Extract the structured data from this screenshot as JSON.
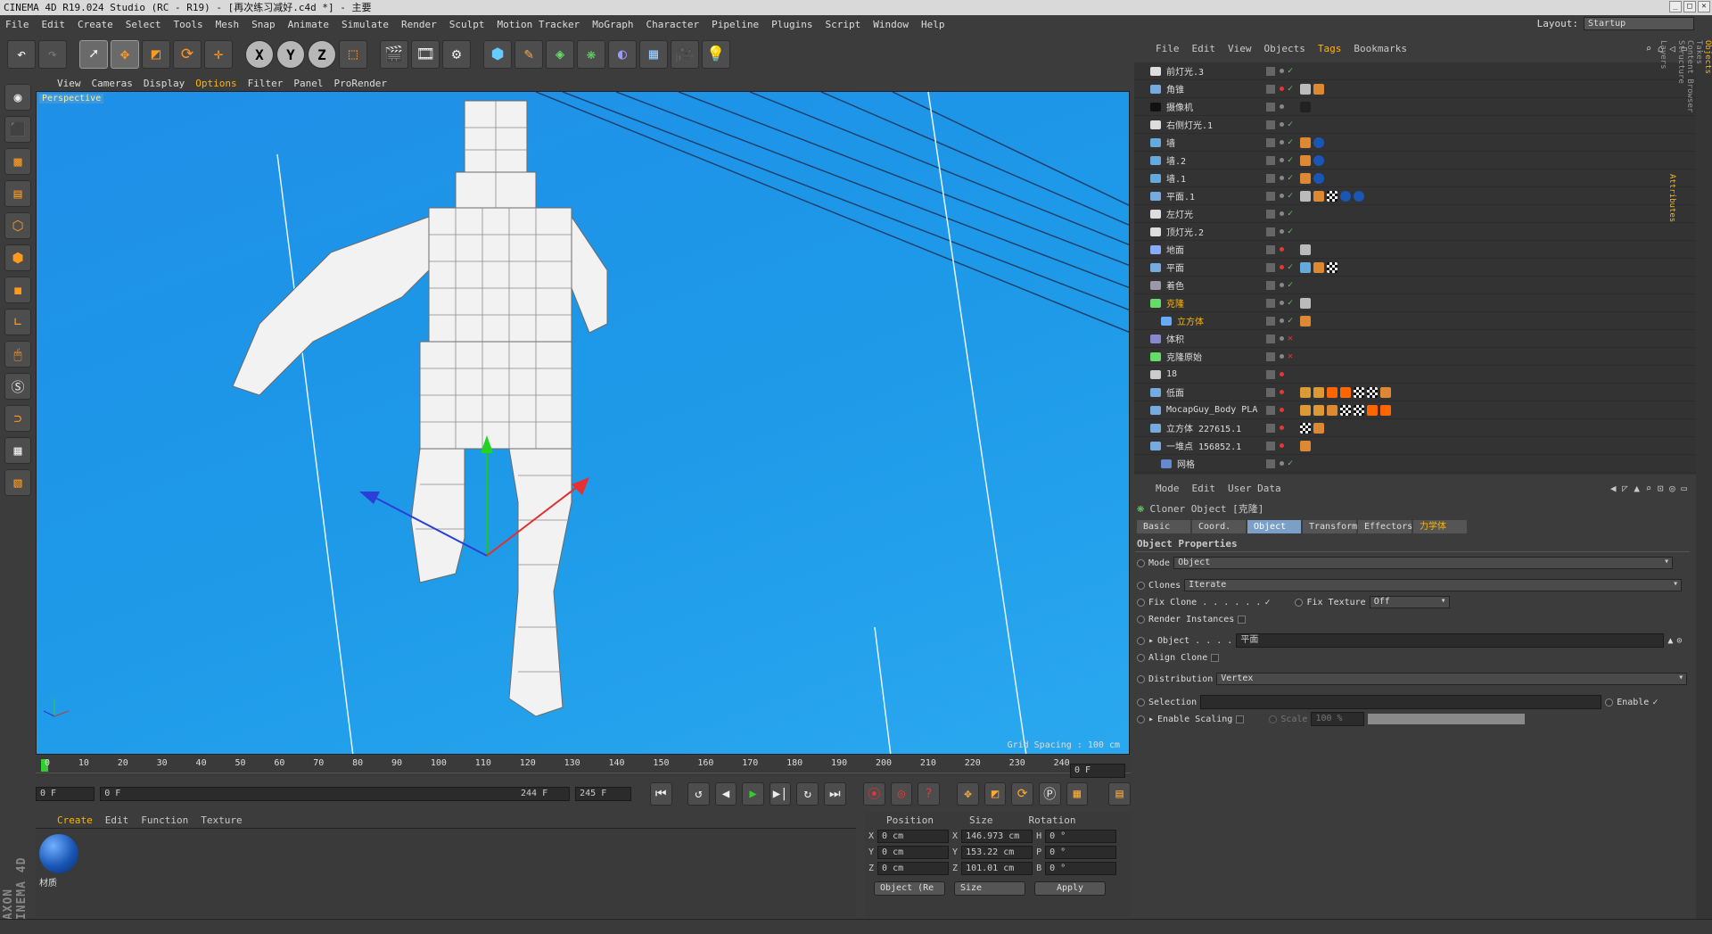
{
  "window": {
    "title": "CINEMA 4D R19.024 Studio (RC - R19) - [再次练习减好.c4d *] - 主要",
    "min": "_",
    "max": "□",
    "close": "✕"
  },
  "menubar": {
    "items": [
      "File",
      "Edit",
      "Create",
      "Select",
      "Tools",
      "Mesh",
      "Snap",
      "Animate",
      "Simulate",
      "Render",
      "Sculpt",
      "Motion Tracker",
      "MoGraph",
      "Character",
      "Pipeline",
      "Plugins",
      "Script",
      "Window",
      "Help"
    ],
    "layout_label": "Layout:",
    "layout_value": "Startup"
  },
  "toolbar": {
    "axis_x": "X",
    "axis_y": "Y",
    "axis_z": "Z"
  },
  "viewport": {
    "menu": [
      "View",
      "Cameras",
      "Display",
      "Options",
      "Filter",
      "Panel",
      "ProRender"
    ],
    "label": "Perspective",
    "grid_spacing": "Grid Spacing : 100 cm"
  },
  "timeline": {
    "ticks": [
      "0",
      "10",
      "20",
      "30",
      "40",
      "50",
      "60",
      "70",
      "80",
      "90",
      "100",
      "110",
      "120",
      "130",
      "140",
      "150",
      "160",
      "170",
      "180",
      "190",
      "200",
      "210",
      "220",
      "230",
      "240"
    ],
    "current_frame": "0 F",
    "start": "0 F",
    "range_start": "0 F",
    "range_end": "244 F",
    "end": "245 F"
  },
  "materials": {
    "menu": [
      "Create",
      "Edit",
      "Function",
      "Texture"
    ],
    "item_name": "材质"
  },
  "coords": {
    "headers": [
      "Position",
      "Size",
      "Rotation"
    ],
    "rows": [
      {
        "axis": "X",
        "pos": "0 cm",
        "size": "146.973 cm",
        "rot_axis": "H",
        "rot": "0 °"
      },
      {
        "axis": "Y",
        "pos": "0 cm",
        "size": "153.22 cm",
        "rot_axis": "P",
        "rot": "0 °"
      },
      {
        "axis": "Z",
        "pos": "0 cm",
        "size": "101.01 cm",
        "rot_axis": "B",
        "rot": "0 °"
      }
    ],
    "mode": "Object (Re",
    "size_mode": "Size",
    "apply": "Apply"
  },
  "objects": {
    "menu": [
      "File",
      "Edit",
      "View",
      "Objects",
      "Tags",
      "Bookmarks"
    ],
    "rows": [
      {
        "name": "前灯光.3",
        "check": "✓"
      },
      {
        "name": "角锥",
        "check": "✓"
      },
      {
        "name": "摄像机",
        "check": ""
      },
      {
        "name": "右侧灯光.1",
        "check": "✓"
      },
      {
        "name": "墙",
        "check": "✓"
      },
      {
        "name": "墙.2",
        "check": "✓"
      },
      {
        "name": "墙.1",
        "check": "✓"
      },
      {
        "name": "平面.1",
        "check": "✓"
      },
      {
        "name": "左灯光",
        "check": "✓"
      },
      {
        "name": "顶灯光.2",
        "check": "✓"
      },
      {
        "name": "地面",
        "check": ""
      },
      {
        "name": "平面",
        "check": "✓"
      },
      {
        "name": "着色",
        "check": "✓"
      },
      {
        "name": "克隆",
        "check": "✓"
      },
      {
        "name": "立方体",
        "check": "✓"
      },
      {
        "name": "体积",
        "check": "✕"
      },
      {
        "name": "克隆原始",
        "check": "✕"
      },
      {
        "name": "18",
        "check": ""
      },
      {
        "name": "低面",
        "check": ""
      },
      {
        "name": "MocapGuy_Body PLA",
        "check": ""
      },
      {
        "name": "立方体 227615.1",
        "check": ""
      },
      {
        "name": "一堆点 156852.1",
        "check": ""
      },
      {
        "name": "网格",
        "check": "✓"
      }
    ]
  },
  "attributes": {
    "menu": [
      "Mode",
      "Edit",
      "User Data"
    ],
    "title": "Cloner Object [克隆]",
    "tabs": [
      "Basic",
      "Coord.",
      "Object",
      "Transform",
      "Effectors",
      "力学体"
    ],
    "section": "Object Properties",
    "mode_label": "Mode",
    "mode_value": "Object",
    "clones_label": "Clones",
    "clones_value": "Iterate",
    "fix_clone": "Fix Clone . . . . . .",
    "fix_clone_check": "✓",
    "fix_texture": "Fix Texture",
    "fix_texture_value": "Off",
    "render_instances": "Render Instances",
    "object_label": "Object . . . .",
    "object_value": "平面",
    "align_clone": "Align Clone",
    "distribution_label": "Distribution",
    "distribution_value": "Vertex",
    "selection_label": "Selection",
    "enable_label": "Enable",
    "enable_check": "✓",
    "enable_scaling": "Enable Scaling",
    "scale_label": "Scale",
    "scale_value": "100 %"
  },
  "right_strip": [
    "Objects",
    "Takes",
    "Content Browser",
    "Structure",
    "Attributes",
    "Layers"
  ]
}
